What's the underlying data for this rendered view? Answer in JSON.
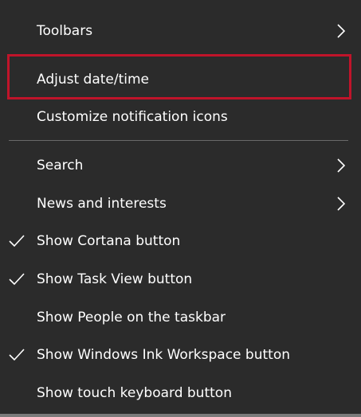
{
  "menu": {
    "items": [
      {
        "label": "Toolbars",
        "checked": false,
        "submenu": true
      },
      {
        "label": "Adjust date/time",
        "checked": false,
        "submenu": false,
        "highlighted": true
      },
      {
        "label": "Customize notification icons",
        "checked": false,
        "submenu": false
      },
      {
        "label": "Search",
        "checked": false,
        "submenu": true
      },
      {
        "label": "News and interests",
        "checked": false,
        "submenu": true
      },
      {
        "label": "Show Cortana button",
        "checked": true,
        "submenu": false
      },
      {
        "label": "Show Task View button",
        "checked": true,
        "submenu": false
      },
      {
        "label": "Show People on the taskbar",
        "checked": false,
        "submenu": false
      },
      {
        "label": "Show Windows Ink Workspace button",
        "checked": true,
        "submenu": false
      },
      {
        "label": "Show touch keyboard button",
        "checked": false,
        "submenu": false
      }
    ],
    "icons": {
      "check": "checkmark-icon",
      "submenu": "chevron-right-icon"
    },
    "colors": {
      "background": "#2b2b2b",
      "text": "#ffffff",
      "highlight_border": "#c0142a",
      "separator": "#6a6a6a"
    }
  }
}
